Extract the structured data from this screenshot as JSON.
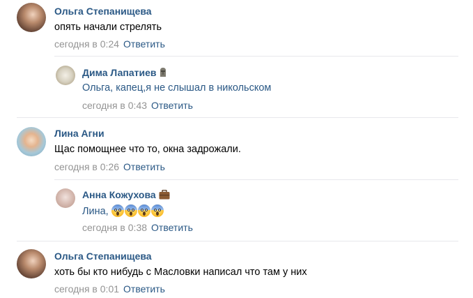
{
  "reply_label": "Ответить",
  "comments": [
    {
      "author": "Ольга Степанищева",
      "text": "опять начали стрелять",
      "time": "сегодня в 0:24"
    },
    {
      "author": "Дима Лапатиев",
      "text": "Ольга, капец,я не слышал в никольском",
      "time": "сегодня в 0:43",
      "badge": "moai-icon"
    },
    {
      "author": "Лина Агни",
      "text": "Щас помощнее что то, окна задрожали.",
      "time": "сегодня в 0:26"
    },
    {
      "author": "Анна Кожухова",
      "text": "Лина,",
      "time": "сегодня в 0:38",
      "badge": "briefcase-icon",
      "emoji": [
        "face-screaming-icon",
        "face-screaming-icon",
        "face-screaming-icon",
        "face-screaming-icon"
      ]
    },
    {
      "author": "Ольга Степанищева",
      "text": "хоть бы кто нибудь с Масловки написал что там у них",
      "time": "сегодня в 0:01"
    }
  ],
  "colors": {
    "link": "#2a5885",
    "meta": "#939393",
    "divider": "#e7e8ec"
  }
}
